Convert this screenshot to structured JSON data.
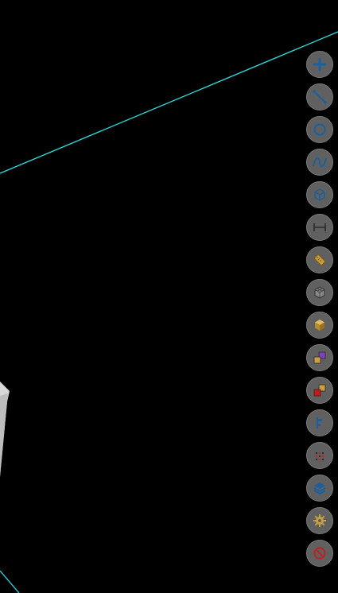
{
  "scene": {
    "background": "#000000",
    "line_color": "#2ed8e8",
    "line_accent": "#38e0a0",
    "solid_face": "#d8d8d8",
    "solid_side": "#b8b8b8"
  },
  "toolbar": {
    "items": [
      {
        "id": "add",
        "icon": "plus-icon"
      },
      {
        "id": "line",
        "icon": "line-segment-icon"
      },
      {
        "id": "circle",
        "icon": "circle-icon"
      },
      {
        "id": "curve",
        "icon": "curve-icon"
      },
      {
        "id": "box",
        "icon": "wireframe-box-icon"
      },
      {
        "id": "dimension",
        "icon": "dimension-icon"
      },
      {
        "id": "ruler",
        "icon": "ruler-icon"
      },
      {
        "id": "mesh",
        "icon": "mesh-cube-icon"
      },
      {
        "id": "solid",
        "icon": "solid-cube-icon"
      },
      {
        "id": "material-purple",
        "icon": "material-swatch-purple-icon"
      },
      {
        "id": "material-red",
        "icon": "material-swatch-red-icon"
      },
      {
        "id": "align",
        "icon": "align-icon"
      },
      {
        "id": "grid",
        "icon": "grid-dots-icon"
      },
      {
        "id": "layers",
        "icon": "layers-icon"
      },
      {
        "id": "settings",
        "icon": "gear-icon"
      },
      {
        "id": "cancel",
        "icon": "cancel-icon"
      }
    ],
    "colors": {
      "button_bg": "#606060",
      "icon_blue": "#1e5f9a",
      "icon_gold": "#c8a040",
      "icon_purple": "#8040c0",
      "icon_red": "#c81818",
      "icon_cancel": "#b02828"
    }
  }
}
